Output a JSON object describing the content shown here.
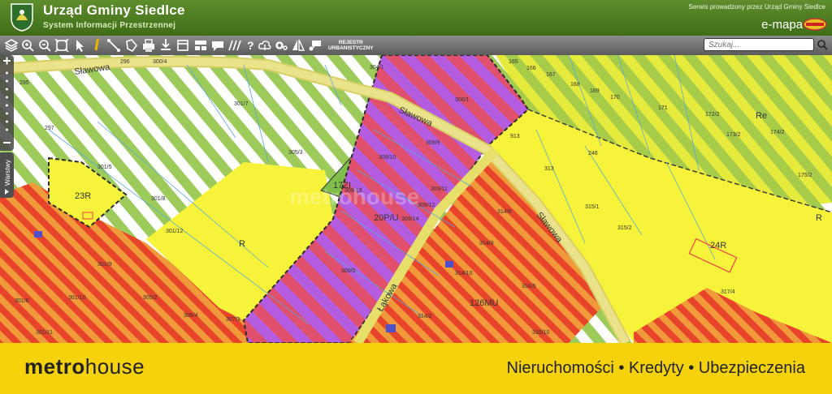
{
  "header": {
    "title": "Urząd Gminy Siedlce",
    "subtitle": "System Informacji Przestrzennej",
    "service_note": "Serwis prowadzony przez Urząd Gminy Siedlce",
    "emapa_label": "e-mapa"
  },
  "toolbar": {
    "registry_line1": "REJESTR",
    "registry_line2": "URBANISTYCZNY",
    "search_placeholder": "Szukaj..."
  },
  "sidebar": {
    "layers_label": "Warstwy"
  },
  "map": {
    "streets": [
      "Sławowa",
      "Sławowa",
      "Sławowa",
      "Łąkowa"
    ],
    "zones": [
      "23R",
      "R",
      "17ZI",
      "20P/U",
      "126MU",
      "24R",
      "Re",
      "R"
    ],
    "parcels": [
      "296",
      "300/4",
      "295",
      "297",
      "301/7",
      "304/1",
      "306/1",
      "165",
      "166",
      "167",
      "168",
      "169",
      "170",
      "171",
      "172/2",
      "173/2",
      "174/2",
      "175/2",
      "913",
      "246",
      "313",
      "315/1",
      "315/2",
      "305/3",
      "309/10",
      "309/9",
      "309/13",
      "309/11",
      "309/12",
      "309/14",
      "301/5",
      "301/8",
      "301/12",
      "301/9",
      "301/6",
      "301/10",
      "305/2",
      "305/4",
      "307/3",
      "301/11",
      "309/5",
      "314/8",
      "314/9",
      "314/10",
      "316/5",
      "314/2",
      "316/10",
      "317/4"
    ],
    "watermark": "metrohouse"
  },
  "banner": {
    "brand_bold": "metro",
    "brand_light": "house",
    "tagline": "Nieruchomości • Kredyty • Ubezpieczenia"
  },
  "colors": {
    "header_green": "#4a7a20",
    "agricultural_yellow": "#f7f23a",
    "residential_red": "#ea4b2a",
    "industrial_purple": "#a45be6",
    "road_yellow": "#e6df6a",
    "banner_yellow": "#f5d20b"
  }
}
